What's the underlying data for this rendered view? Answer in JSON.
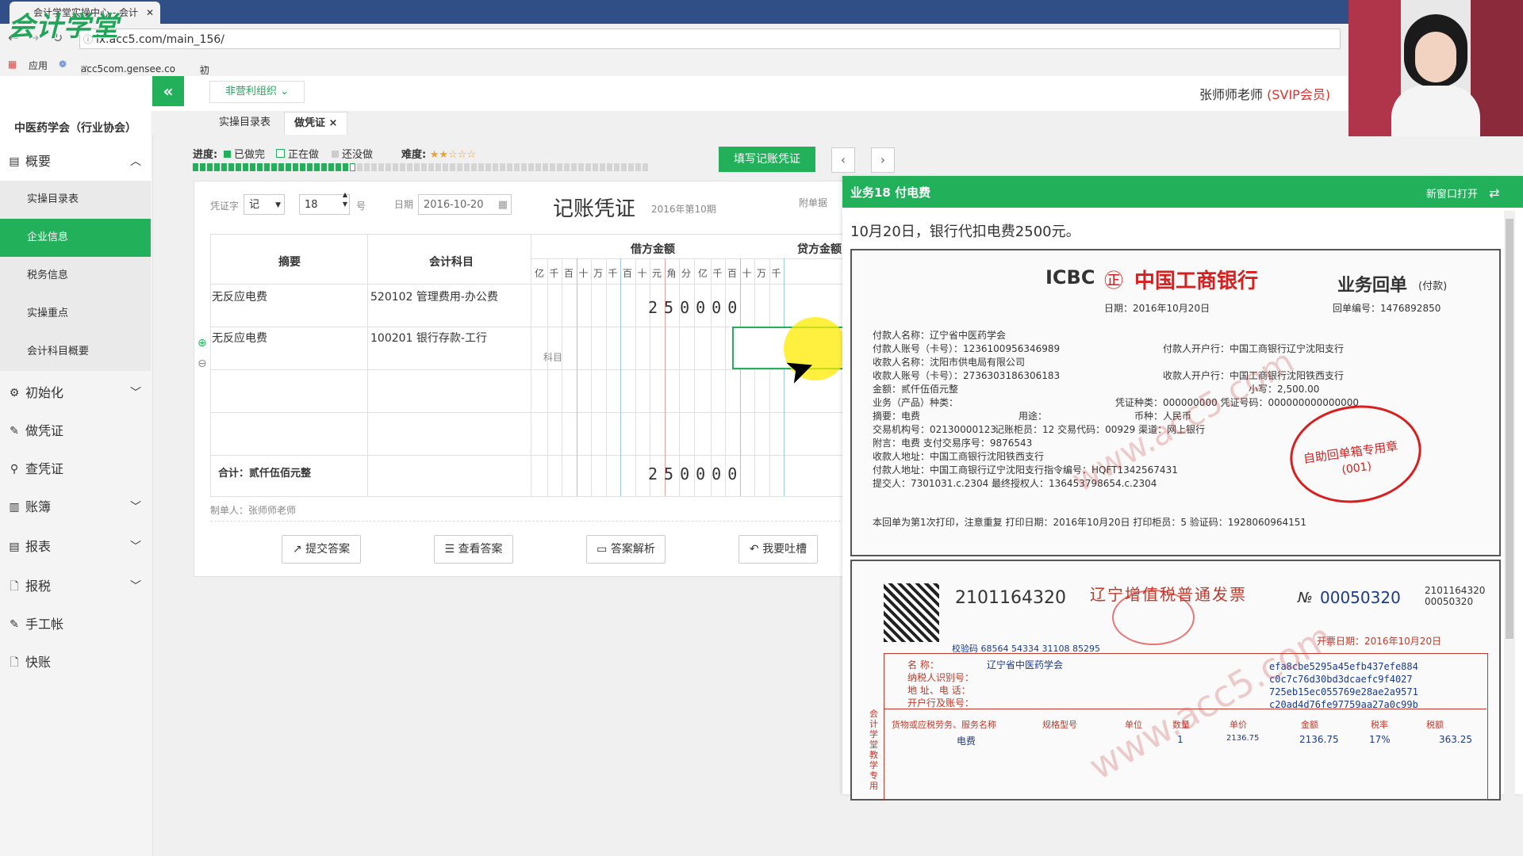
{
  "browser": {
    "tab_title": "会计学堂实操中心 - 会计",
    "url": "lx.acc5.com/main_156/",
    "bookmarks": [
      "应用",
      "acc5com.gensee.co",
      "初级"
    ]
  },
  "logo_text": "会计学堂",
  "header": {
    "org_select": "非营利组织",
    "user_name": "张师师老师",
    "user_level": "(SVIP会员)"
  },
  "sidebar": {
    "title": "中医药学会（行业协会）",
    "sections": [
      {
        "label": "概要",
        "icon": "grid-icon",
        "expanded": true,
        "items": [
          "实操目录表",
          "企业信息",
          "税务信息",
          "实操重点",
          "会计科目概要"
        ]
      },
      {
        "label": "初始化",
        "icon": "gear-icon"
      },
      {
        "label": "做凭证",
        "icon": "pen-icon"
      },
      {
        "label": "查凭证",
        "icon": "search-icon"
      },
      {
        "label": "账簿",
        "icon": "book-icon"
      },
      {
        "label": "报表",
        "icon": "report-icon"
      },
      {
        "label": "报税",
        "icon": "file-icon"
      },
      {
        "label": "手工帐",
        "icon": "pen-icon"
      },
      {
        "label": "快账",
        "icon": "file-icon"
      }
    ],
    "active_item": "企业信息"
  },
  "page_tabs": [
    {
      "label": "实操目录表",
      "active": false
    },
    {
      "label": "做凭证",
      "active": true,
      "close": "×"
    }
  ],
  "progress": {
    "label": "进度:",
    "legend_done": "已做完",
    "legend_doing": "正在做",
    "legend_todo": "还没做",
    "difficulty_label": "难度:",
    "difficulty_stars": "★★☆☆☆",
    "done_count": 22,
    "current_index": 22,
    "total": 64
  },
  "fill_button": "填写记账凭证",
  "nav": {
    "prev": "‹",
    "next": "›"
  },
  "voucher": {
    "word_label": "凭证字",
    "word_value": "记",
    "number_value": "18",
    "number_suffix": "号",
    "date_label": "日期",
    "date_value": "2016-10-20",
    "title": "记账凭证",
    "period": "2016年第10期",
    "attach_label": "附单据",
    "col_summary": "摘要",
    "col_account": "会计科目",
    "col_debit": "借方金额",
    "col_credit": "贷方金额",
    "digit_headers": [
      "亿",
      "千",
      "百",
      "十",
      "万",
      "千",
      "百",
      "十",
      "元",
      "角",
      "分"
    ],
    "rows": [
      {
        "summary": "无反应电费",
        "account": "520102 管理费用-办公费",
        "debit": "250000",
        "credit": ""
      },
      {
        "summary": "无反应电费",
        "account": "100201 银行存款-工行",
        "account_hint": "科目",
        "debit": "",
        "credit": ""
      },
      {
        "summary": "",
        "account": "",
        "debit": "",
        "credit": ""
      },
      {
        "summary": "",
        "account": "",
        "debit": "",
        "credit": ""
      }
    ],
    "total_label": "合计：贰仟伍佰元整",
    "total_debit": "250000",
    "maker": "制单人：张师师老师",
    "buttons": [
      "提交答案",
      "查看答案",
      "答案解析",
      "我要吐槽"
    ]
  },
  "task_panel": {
    "title": "业务18 付电费",
    "new_window": "新窗口打开",
    "description": "10月20日，银行代扣电费2500元。",
    "receipt": {
      "bank": "ICBC",
      "bank_name": "中国工商银行",
      "doc_title": "业务回单",
      "doc_sub": "(付款)",
      "date": "日期：2016年10月20日",
      "doc_no": "回单编号：1476892850",
      "lines": [
        "付款人名称：辽宁省中医药学会",
        "付款人账号（卡号）：1236100956346989",
        "收款人名称：沈阳市供电局有限公司",
        "收款人账号（卡号）：2736303186306183",
        "金额：贰仟伍佰元整",
        "业务（产品）种类：",
        "摘要：电费",
        "交易机构号：02130000123",
        "附言：电费      支付交易序号：9876543",
        "收款人地址：中国工商银行沈阳铁西支行",
        "付款人地址：中国工商银行辽宁沈阳支行指令编号：HQFT1342567431",
        "提交人：7301031.c.2304 最终授权人：136453798654.c.2304"
      ],
      "right_lines": [
        "付款人开户行：中国工商银行辽宁沈阳支行",
        "收款人开户行：中国工商银行沈阳铁西支行",
        "小写：2,500.00",
        "凭证种类：000000000 凭证号码：000000000000000",
        "币种：人民币",
        "记账柜员：12    交易代码：00929    渠道：网上银行",
        "用途："
      ],
      "footer": "本回单为第1次打印，注意重复  打印日期：2016年10月20日  打印柜员：5  验证码：1928060964151",
      "stamp_text": "自助回单箱专用章",
      "stamp_no": "(001)",
      "watermark": "www.acc5.com"
    },
    "invoice": {
      "code": "2101164320",
      "title": "辽宁增值税普通发票",
      "no_label": "№",
      "no_value": "00050320",
      "code_small": "2101164320",
      "no_small": "00050320",
      "check_code": "校验码 68564 54334 31108 85295",
      "issue_date": "开票日期：2016年10月20日",
      "buyer_name_label": "名      称：",
      "buyer_name": "辽宁省中医药学会",
      "buyer_tax_label": "纳税人识别号：",
      "buyer_addr_label": "地 址、电 话：",
      "buyer_bank_label": "开户行及账号：",
      "cipher": [
        "efa8cbe5295a45efb437efe884",
        "c0c7c76d30bd3dcaefc9f4027",
        "725eb15ec055769e28ae2a9571",
        "c20ad4d76fe97759aa27a0c99b"
      ],
      "cols": [
        "货物或应税劳务、服务名称",
        "规格型号",
        "单位",
        "数量",
        "单价",
        "金额",
        "税率",
        "税额"
      ],
      "item": {
        "name": "电费",
        "qty": "1",
        "price": "2136.75",
        "amount": "2136.75",
        "rate": "17%",
        "tax": "363.25"
      },
      "side_label": "会计学堂教学专用",
      "watermark": "www.acc5.com"
    }
  },
  "colors": {
    "accent": "#22b05a",
    "danger": "#e03030",
    "stamp": "#d81e1e"
  }
}
